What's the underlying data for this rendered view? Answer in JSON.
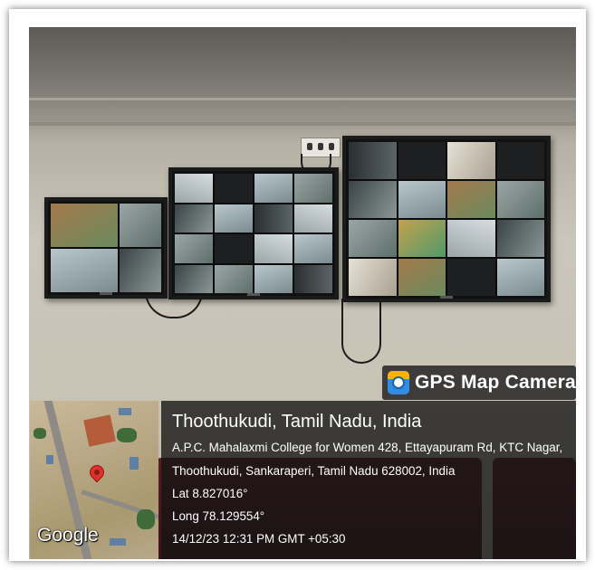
{
  "badge": {
    "label": "GPS Map Camera",
    "icon": "gps-map-camera-app-icon"
  },
  "map": {
    "brand": "Google"
  },
  "location": {
    "city": "Thoothukudi, Tamil Nadu, India",
    "address_line1": "A.P.C. Mahalaxmi College for Women 428, Ettayapuram Rd, KTC Nagar,",
    "address_line2": "Thoothukudi, Sankaraperi, Tamil Nadu 628002, India",
    "lat": "Lat 8.827016°",
    "long": "Long 78.129554°",
    "timestamp": "14/12/23 12:31 PM GMT +05:30"
  },
  "colors": {
    "overlay": "#1e1e1e",
    "pin": "#e0302a",
    "badge_icon_top": "#ffb300",
    "badge_icon_bottom": "#2f8de4"
  }
}
